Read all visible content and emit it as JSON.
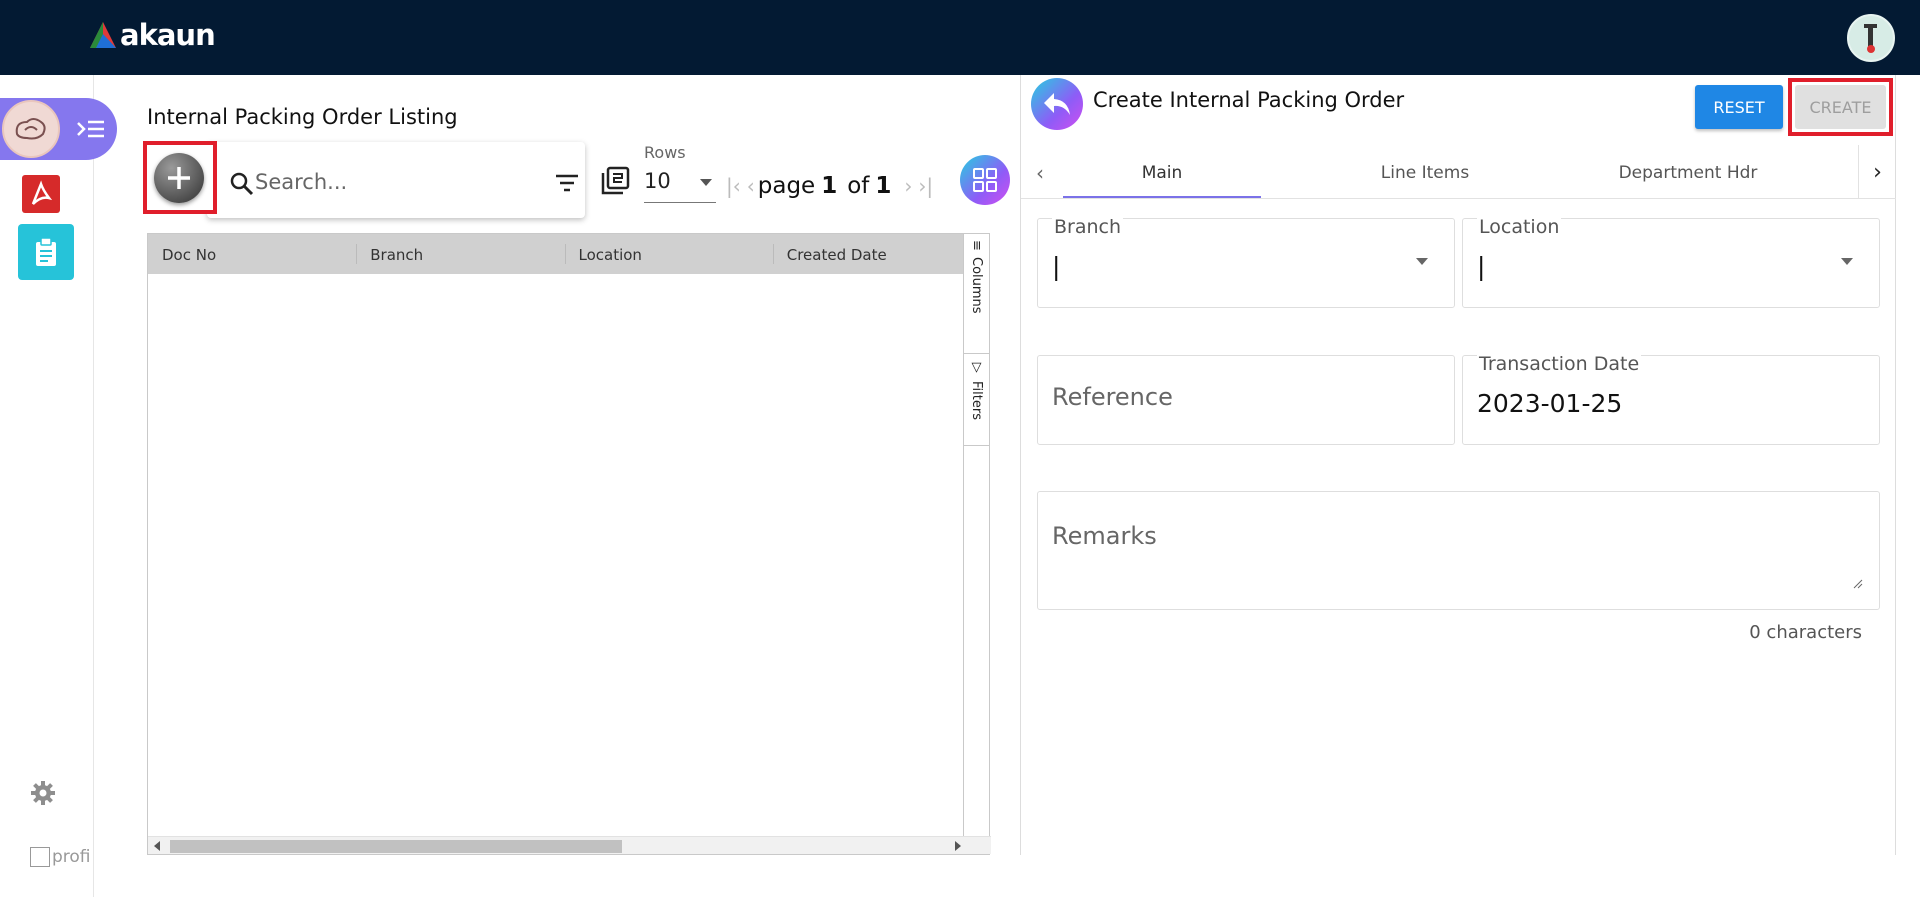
{
  "app": {
    "brand": "akaun",
    "colors": {
      "topbar": "#031a33",
      "accent": "#7b72e8",
      "primary": "#1f87e5",
      "highlight": "#e01e2b"
    }
  },
  "rail": {
    "profile_label": "profi",
    "icons": [
      "user-avatar-icon",
      "menu-toggle-icon",
      "pdf-app-icon",
      "clipboard-app-icon",
      "settings-icon"
    ]
  },
  "listing": {
    "title": "Internal Packing Order Listing",
    "search_placeholder": "Search...",
    "rows_label": "Rows",
    "rows_value": "10",
    "pager": {
      "page_word": "page",
      "current": "1",
      "of_word": "of",
      "total": "1"
    },
    "columns": [
      "Doc No",
      "Branch",
      "Location",
      "Created Date"
    ],
    "side_tabs": [
      "Columns",
      "Filters"
    ]
  },
  "create": {
    "title": "Create Internal Packing Order",
    "reset_label": "RESET",
    "create_label": "CREATE",
    "tabs": [
      {
        "label": "Main",
        "active": true
      },
      {
        "label": "Line Items",
        "active": false
      },
      {
        "label": "Department Hdr",
        "active": false
      }
    ],
    "fields": {
      "branch": {
        "label": "Branch",
        "value": "|"
      },
      "location": {
        "label": "Location",
        "value": "|"
      },
      "reference": {
        "placeholder": "Reference"
      },
      "transaction_date": {
        "label": "Transaction Date",
        "value": "2023-01-25"
      },
      "remarks": {
        "placeholder": "Remarks"
      }
    },
    "char_count": "0 characters"
  }
}
